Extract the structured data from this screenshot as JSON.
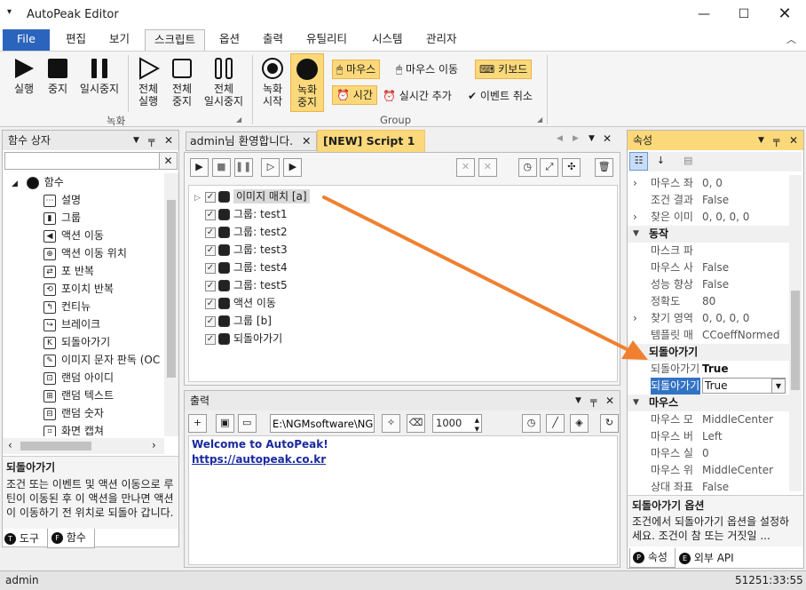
{
  "app": {
    "title": "AutoPeak Editor",
    "status_user": "admin",
    "status_time": "51251:33:55"
  },
  "menu_tabs": [
    "File",
    "편집",
    "보기",
    "스크립트",
    "옵션",
    "출력",
    "유틸리티",
    "시스템",
    "관리자"
  ],
  "ribbon": {
    "record_group": "녹화",
    "group2": "Group",
    "rec_play": "실행",
    "rec_stop": "중지",
    "rec_pause": "일시중지",
    "all_play_1": "전체",
    "all_play_2": "실행",
    "all_stop_1": "전체",
    "all_stop_2": "중지",
    "all_pause_1": "전체",
    "all_pause_2": "일시중지",
    "rec_start_1": "녹화",
    "rec_start_2": "시작",
    "rec_stop_1": "녹화",
    "rec_stop_2": "중지",
    "mouse": "마우스",
    "mouse_move": "마우스 이동",
    "keyboard": "키보드",
    "time": "시간",
    "realtime_add": "실시간 추가",
    "event_cancel": "이벤트 취소"
  },
  "functions": {
    "title": "함수 상자",
    "root": "함수",
    "items": [
      "설명",
      "그룹",
      "액션 이동",
      "액션 이동 위치",
      "포 반복",
      "포이치 반복",
      "컨티뉴",
      "브레이크",
      "되돌아가기",
      "이미지 문자 판독 (OC",
      "랜덤 아이디",
      "랜덤 텍스트",
      "랜덤 숫자",
      "화면 캡쳐"
    ],
    "desc_title": "되돌아가기",
    "desc_text": "조건 또는 이벤트 및 액션 이동으로 루틴이 이동된 후 이 액션을 만나면 액션이 이동하기 전 위치로 되돌아 갑니다.",
    "tab_tools": "도구",
    "tab_functions": "함수"
  },
  "editor": {
    "tab1": "admin님 환영합니다.",
    "tab2": "[NEW] Script 1",
    "rows": [
      "이미지 매치 [a]",
      "그룹: test1",
      "그룹: test2",
      "그룹: test3",
      "그룹: test4",
      "그룹: test5",
      "액션 이동",
      "그룹 [b]",
      "되돌아가기"
    ]
  },
  "output": {
    "title": "출력",
    "path": "E:\\NGMsoftware\\NG",
    "count": "1000",
    "welcome": "Welcome to AutoPeak!",
    "url": "https://autopeak.co.kr"
  },
  "props": {
    "title": "속성",
    "rows": [
      {
        "k": "row",
        "n": "마우스 좌",
        "v": "0, 0",
        "exp": "›"
      },
      {
        "k": "row",
        "n": "조건 결과",
        "v": "False"
      },
      {
        "k": "row",
        "n": "찾은 이미",
        "v": "0, 0, 0, 0",
        "exp": "›"
      },
      {
        "k": "cat",
        "n": "동작"
      },
      {
        "k": "row",
        "n": "마스크 파",
        "v": ""
      },
      {
        "k": "row",
        "n": "마우스 사",
        "v": "False"
      },
      {
        "k": "row",
        "n": "성능 향상",
        "v": "False"
      },
      {
        "k": "row",
        "n": "정확도",
        "v": "80"
      },
      {
        "k": "row",
        "n": "찾기 영역",
        "v": "0, 0, 0, 0",
        "exp": "›"
      },
      {
        "k": "row",
        "n": "템플릿 매",
        "v": "CCoeffNormed"
      },
      {
        "k": "cat",
        "n": "되돌아가기"
      },
      {
        "k": "row",
        "n": "되돌아가기",
        "v": "True",
        "bold": true
      },
      {
        "k": "sel",
        "n": "되돌아가기",
        "v": "True"
      },
      {
        "k": "cat",
        "n": "마우스"
      },
      {
        "k": "row",
        "n": "마우스 모",
        "v": "MiddleCenter"
      },
      {
        "k": "row",
        "n": "마우스 버",
        "v": "Left"
      },
      {
        "k": "row",
        "n": "마우스 실",
        "v": "0"
      },
      {
        "k": "row",
        "n": "마우스 위",
        "v": "MiddleCenter"
      },
      {
        "k": "row",
        "n": "상대 좌표",
        "v": "False"
      }
    ],
    "desc_title": "되돌아가기 옵션",
    "desc_text": "조건에서 되돌아가기 옵션을 설정하세요. 조건이 참 또는 거짓일 ...",
    "tab_props": "속성",
    "tab_api": "외부 API"
  }
}
